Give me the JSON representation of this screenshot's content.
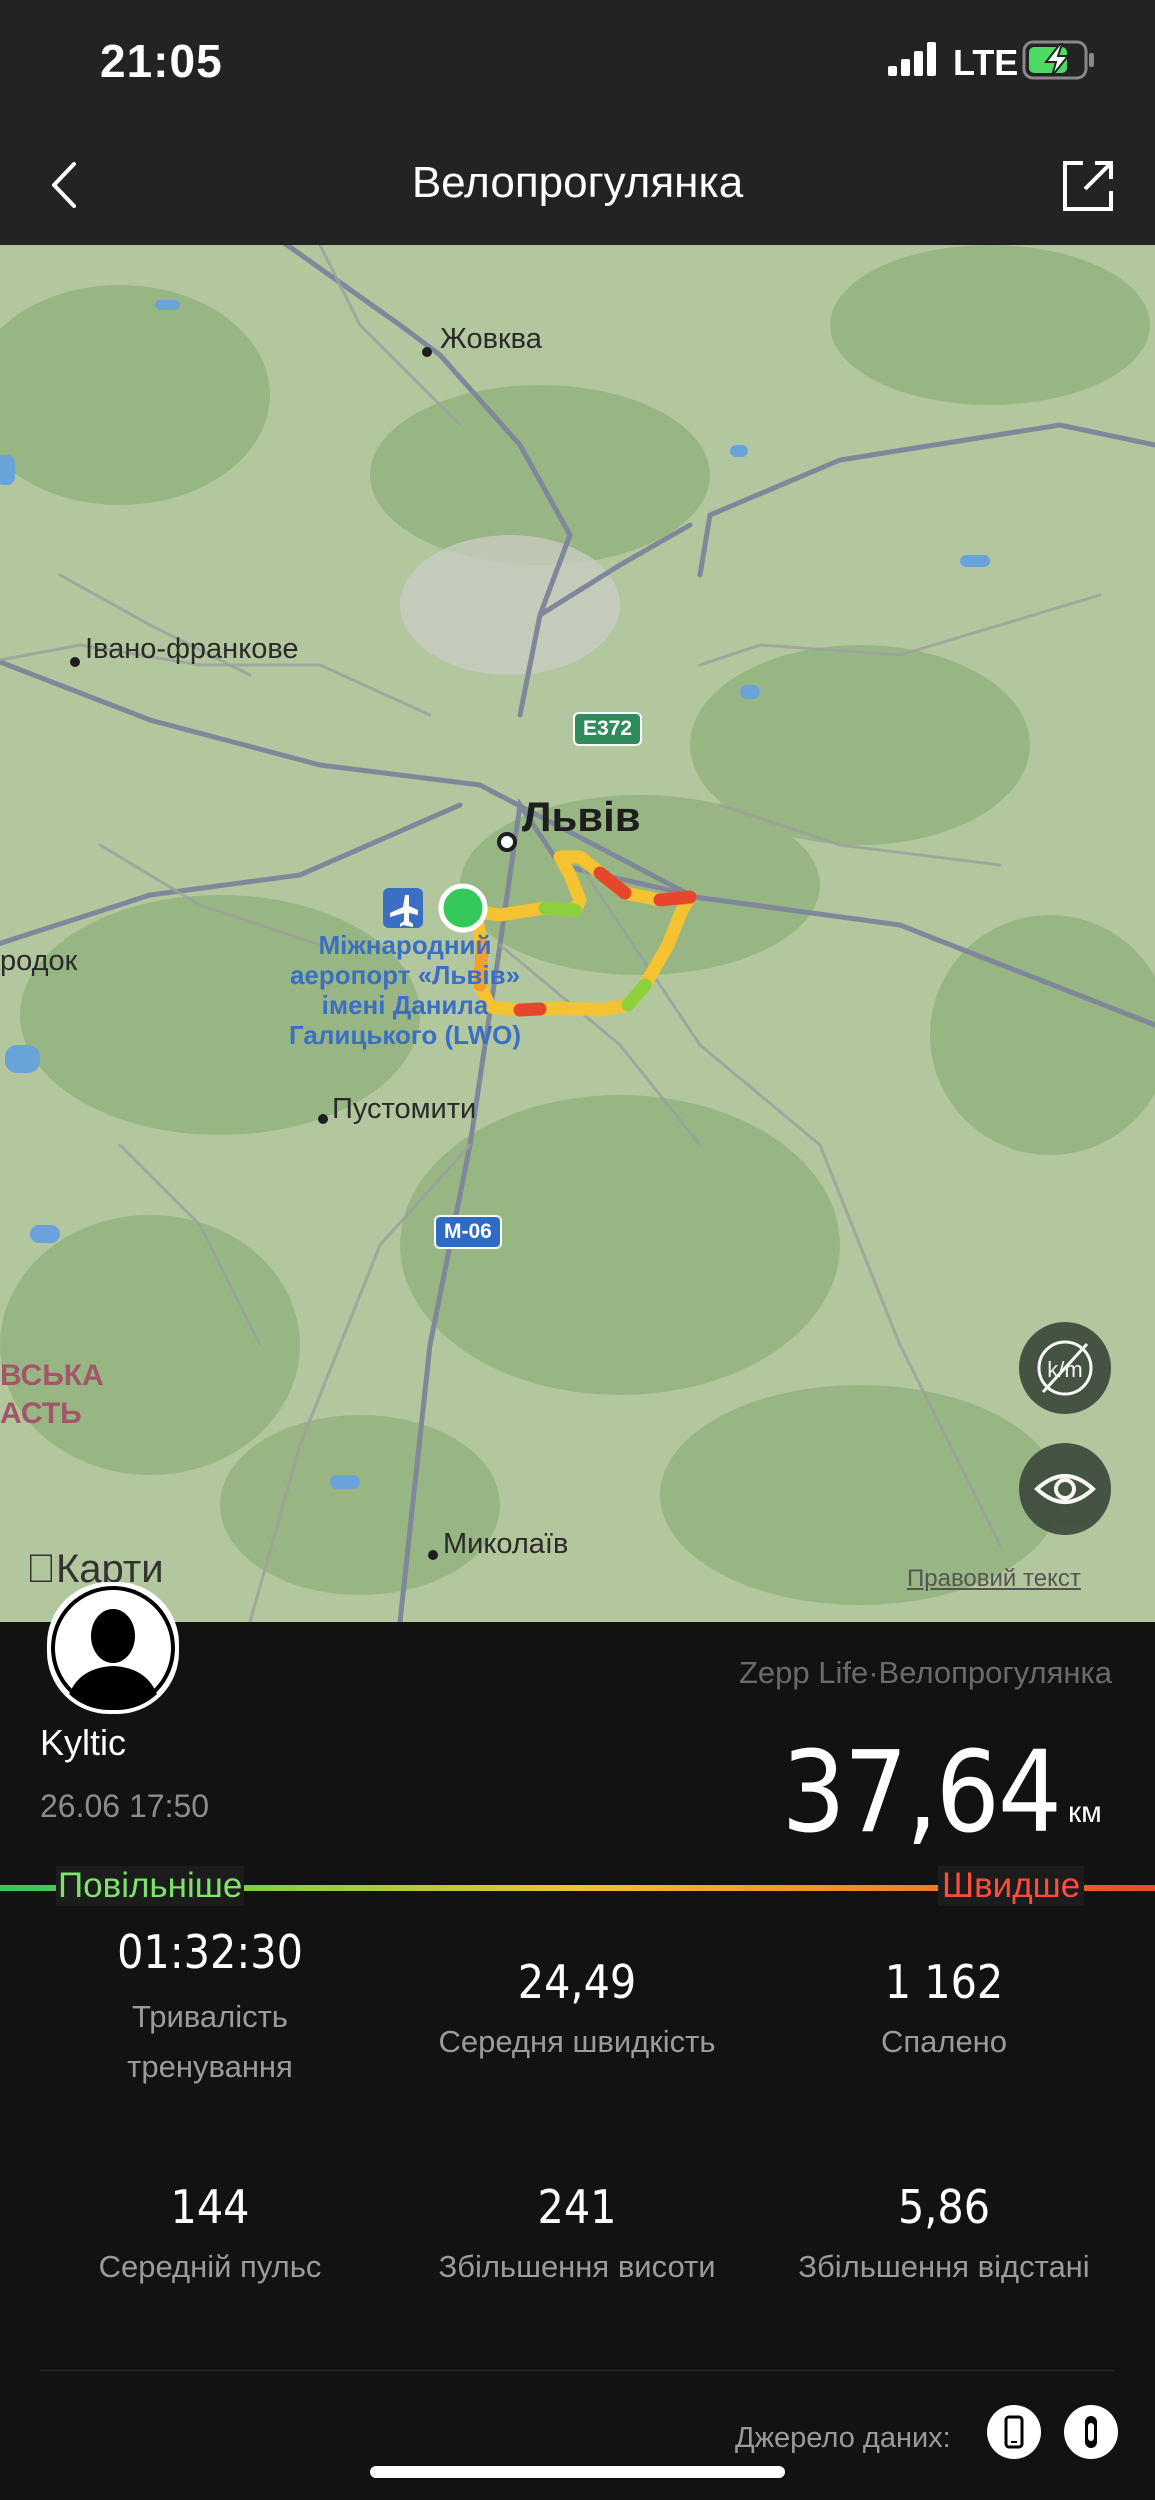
{
  "status_bar": {
    "time": "21:05",
    "network": "LTE",
    "signal_icon": "signal-bars-icon",
    "battery_icon": "battery-charging-icon"
  },
  "nav": {
    "title": "Велопрогулянка",
    "back_icon": "chevron-left-icon",
    "share_icon": "share-icon"
  },
  "map": {
    "places": {
      "zhovkva": "Жовква",
      "ivano_frankove": "Івано-франкове",
      "lviv": "Львів",
      "gorodok": "родок",
      "pustomyty": "Пустомити",
      "mykolaiv": "Миколаїв",
      "airport_line1": "Міжнародний",
      "airport_line2": "аеропорт «Львів»",
      "airport_line3": "імені Данила",
      "airport_line4": "Галицького (LWO)",
      "region_line1": "ВСЬКА",
      "region_line2": "АСТЬ"
    },
    "roads": {
      "e372": "E372",
      "m06": "M-06"
    },
    "maps_logo": "Карти",
    "attribution": "Правовий текст",
    "buttons": {
      "units_icon": "km-mile-toggle-icon",
      "visibility_icon": "eye-icon"
    },
    "route_colors": {
      "slow": "#34c759",
      "medium": "#f5c231",
      "fast": "#e8462c"
    }
  },
  "workout": {
    "username": "Kyltic",
    "datetime": "26.06 17:50",
    "source_app": "Zepp Life·Велопрогулянка",
    "distance": "37,64",
    "distance_unit": "км",
    "scale_slower": "Повільніше",
    "scale_faster": "Швидше"
  },
  "stats": [
    {
      "value": "01:32:30",
      "label_line1": "Тривалість",
      "label_line2": "тренування"
    },
    {
      "value": "24,49",
      "label_line1": "Середня швидкість",
      "label_line2": ""
    },
    {
      "value": "1 162",
      "label_line1": "Спалено",
      "label_line2": ""
    },
    {
      "value": "144",
      "label_line1": "Середній пульс",
      "label_line2": ""
    },
    {
      "value": "241",
      "label_line1": "Збільшення висоти",
      "label_line2": ""
    },
    {
      "value": "5,86",
      "label_line1": "Збільшення відстані",
      "label_line2": ""
    }
  ],
  "data_source": {
    "label": "Джерело даних:",
    "icons": [
      "phone-icon",
      "band-icon"
    ]
  }
}
